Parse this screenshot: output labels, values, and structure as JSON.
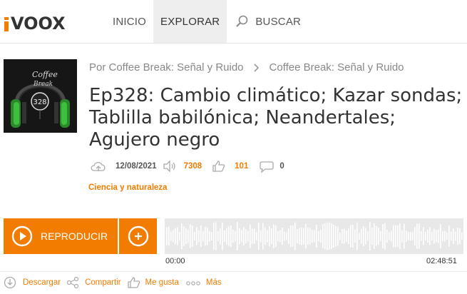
{
  "header": {
    "logo": "ivoox",
    "logo_text": "VOOX",
    "nav": {
      "home": "INICIO",
      "explore": "EXPLORAR",
      "search": "BUSCAR"
    },
    "search_icon": "search-icon"
  },
  "episode": {
    "cover_text": "Coffee Break 328",
    "breadcrumb": {
      "author": "Por Coffee Break: Señal y Ruido",
      "program": "Coffee Break: Señal y Ruido"
    },
    "title": "Ep328: Cambio climático; Kazar sondas; Tablilla babilónica; Neandertales; Agujero negro",
    "date": "12/08/2021",
    "plays": "7308",
    "likes": "101",
    "comments": "0",
    "category": "Ciencia y naturaleza"
  },
  "player": {
    "play_label": "REPRODUCIR",
    "time_start": "00:00",
    "time_end": "02:48:51",
    "progress": 0
  },
  "actions": {
    "download": "Descargar",
    "share": "Compartir",
    "like": "Me gusta",
    "more": "Más"
  },
  "colors": {
    "accent": "#f17c00",
    "text": "#333333",
    "muted": "#888888",
    "waveform": "#ffffff",
    "waveform_bg": "#e8e8e8"
  }
}
